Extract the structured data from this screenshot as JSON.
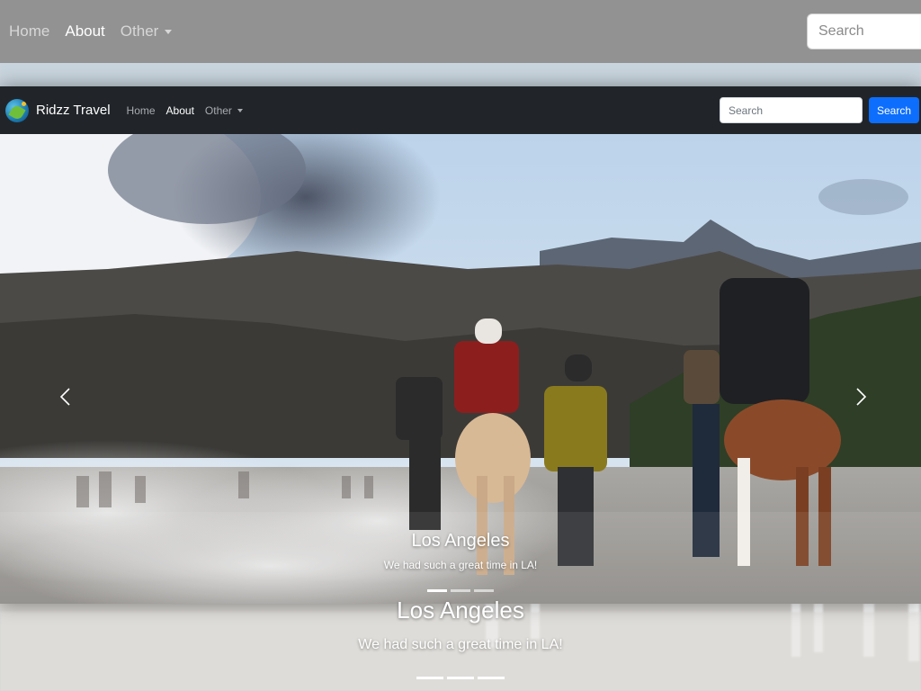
{
  "background_nav": {
    "items": [
      {
        "label": "Home",
        "active": false
      },
      {
        "label": "About",
        "active": true
      },
      {
        "label": "Other",
        "active": false,
        "dropdown": true
      }
    ],
    "search_placeholder": "Search"
  },
  "background_caption": {
    "title": "Los Angeles",
    "text": "We had such a great time in LA!"
  },
  "navbar": {
    "brand": "Ridzz Travel",
    "items": [
      {
        "label": "Home",
        "active": false
      },
      {
        "label": "About",
        "active": true
      },
      {
        "label": "Other",
        "active": false,
        "dropdown": true
      }
    ],
    "search_placeholder": "Search",
    "search_button": "Search"
  },
  "carousel": {
    "caption_title": "Los Angeles",
    "caption_text": "We had such a great time in LA!",
    "indicator_count": 3,
    "prev_icon": "chevron-left-icon",
    "next_icon": "chevron-right-icon"
  },
  "colors": {
    "navbar_bg": "#212529",
    "primary_button": "#0d6efd",
    "ghost_nav_bg": "#929292"
  }
}
